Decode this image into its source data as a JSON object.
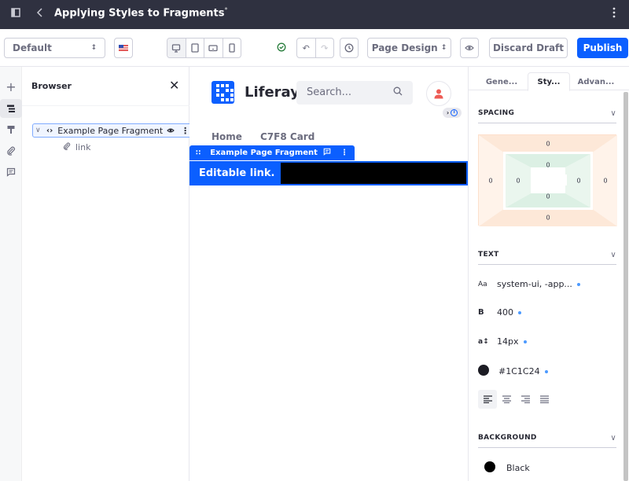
{
  "topbar": {
    "title": "Applying Styles to Fragments",
    "modified_marker": "*",
    "icons": {
      "sidebar": "sidebar-toggle-icon",
      "back": "back-icon",
      "more": "more-vertical-icon"
    }
  },
  "toolbar": {
    "experience_select": "Default",
    "language_flag": "en-US",
    "devices": [
      "desktop",
      "tablet",
      "landscape-phone",
      "portrait-phone"
    ],
    "active_device": "desktop",
    "status": "saved",
    "page_design_label": "Page Design",
    "discard_label": "Discard Draft",
    "publish_label": "Publish",
    "publish_color": "#0b5fff"
  },
  "left_rail": {
    "items": [
      "add",
      "browser",
      "page-design",
      "mapping",
      "comments"
    ],
    "active": "browser"
  },
  "browser": {
    "title": "Browser",
    "tree": {
      "label": "Example Page Fragment",
      "children": [
        {
          "label": "link"
        }
      ]
    }
  },
  "canvas": {
    "brand": "Liferay",
    "search_placeholder": "Search...",
    "nav": [
      "Home",
      "C7F8 Card"
    ],
    "fragment_name": "Example Page Fragment",
    "editable_link": "Editable link."
  },
  "panel": {
    "tabs": [
      "Gene...",
      "Sty...",
      "Advan..."
    ],
    "active_tab": "Sty...",
    "spacing": {
      "title": "SPACING",
      "margin": {
        "top": "0",
        "right": "0",
        "bottom": "0",
        "left": "0"
      },
      "padding": {
        "top": "0",
        "right": "0",
        "bottom": "0",
        "left": "0"
      }
    },
    "text": {
      "title": "TEXT",
      "font_family": "system-ui, -app...",
      "font_weight": "400",
      "font_size": "14px",
      "color": "#1C1C24",
      "color_swatch": "#1c1c24",
      "alignments": [
        "left",
        "center",
        "right",
        "justify"
      ],
      "active_alignment": "left"
    },
    "background": {
      "title": "BACKGROUND",
      "color_label": "Black",
      "color_swatch": "#000000"
    }
  }
}
